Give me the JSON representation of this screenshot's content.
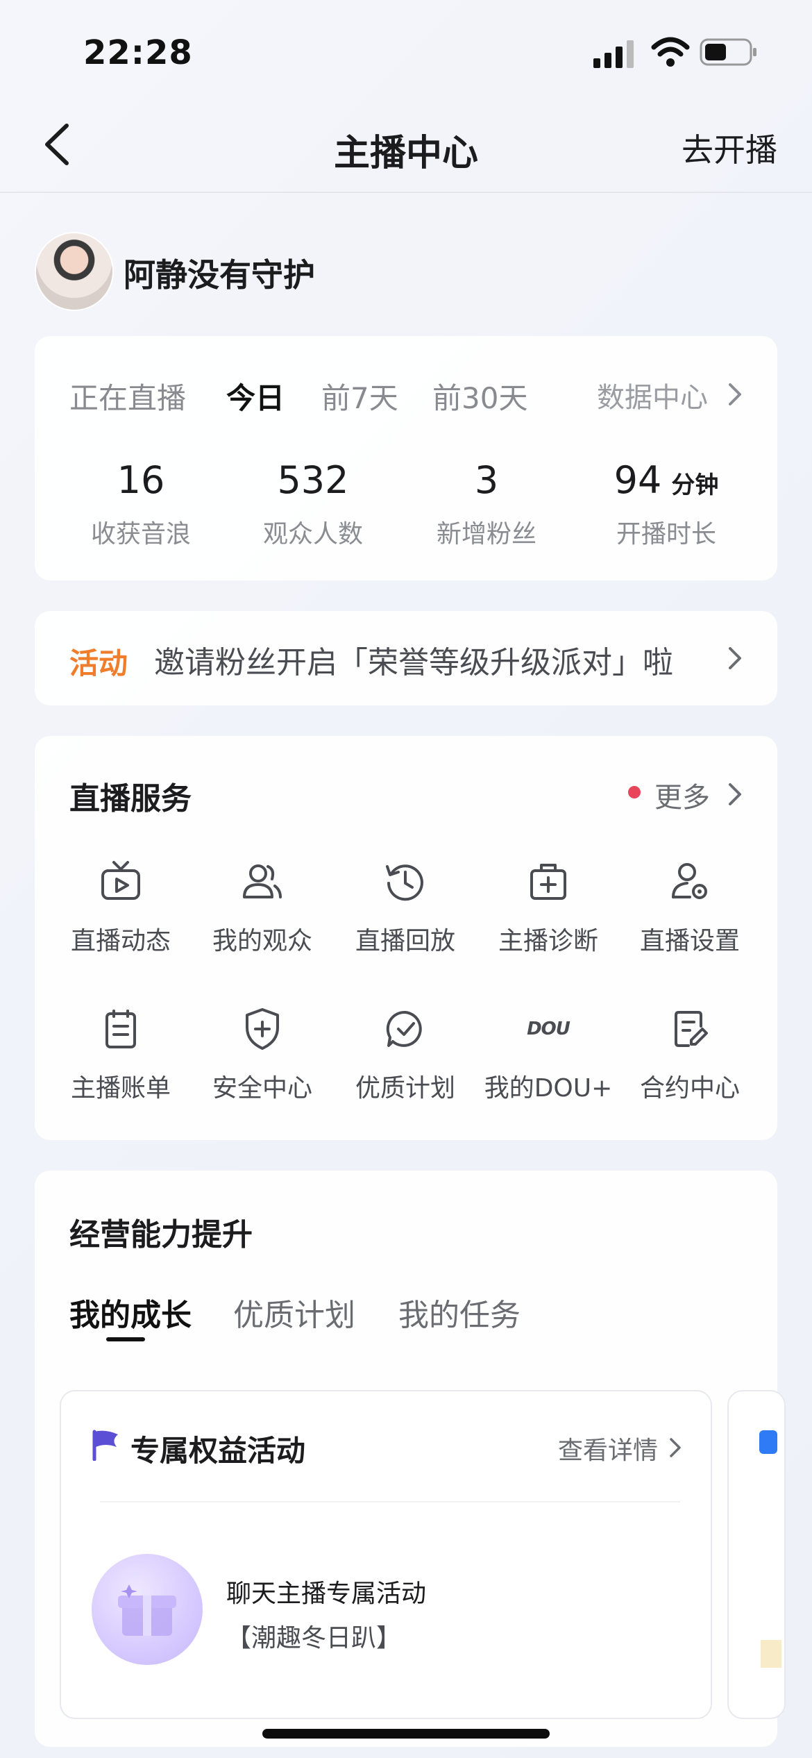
{
  "status_bar": {
    "time": "22:28"
  },
  "nav": {
    "title": "主播中心",
    "action": "去开播"
  },
  "profile": {
    "name": "阿静没有守护"
  },
  "stats": {
    "tabs": [
      "正在直播",
      "今日",
      "前7天",
      "前30天"
    ],
    "active_tab": "今日",
    "data_center": "数据中心",
    "items": [
      {
        "value": "16",
        "unit": "",
        "label": "收获音浪"
      },
      {
        "value": "532",
        "unit": "",
        "label": "观众人数"
      },
      {
        "value": "3",
        "unit": "",
        "label": "新增粉丝"
      },
      {
        "value": "94",
        "unit": "分钟",
        "label": "开播时长"
      }
    ]
  },
  "activity": {
    "tag": "活动",
    "text": "邀请粉丝开启「荣誉等级升级派对」啦"
  },
  "services": {
    "title": "直播服务",
    "more": "更多",
    "items": [
      {
        "label": "直播动态",
        "icon": "tv-play-icon"
      },
      {
        "label": "我的观众",
        "icon": "users-icon"
      },
      {
        "label": "直播回放",
        "icon": "history-icon"
      },
      {
        "label": "主播诊断",
        "icon": "medical-kit-icon"
      },
      {
        "label": "直播设置",
        "icon": "user-settings-icon"
      },
      {
        "label": "主播账单",
        "icon": "clipboard-icon"
      },
      {
        "label": "安全中心",
        "icon": "shield-plus-icon"
      },
      {
        "label": "优质计划",
        "icon": "check-circle-icon"
      },
      {
        "label": "我的DOU+",
        "icon": "dou-logo-icon"
      },
      {
        "label": "合约中心",
        "icon": "contract-edit-icon"
      }
    ],
    "dou_logo_text": "DOU"
  },
  "operations": {
    "title": "经营能力提升",
    "tabs": [
      "我的成长",
      "优质计划",
      "我的任务"
    ],
    "active_tab": "我的成长",
    "card": {
      "title": "专属权益活动",
      "detail": "查看详情",
      "line1": "聊天主播专属活动",
      "line2": "【潮趣冬日趴】"
    }
  },
  "colors": {
    "activity_tag": "#f07d2b",
    "more_dot": "#e8455a",
    "flag": "#5b4fd6",
    "gift": "#c6b6fa"
  }
}
